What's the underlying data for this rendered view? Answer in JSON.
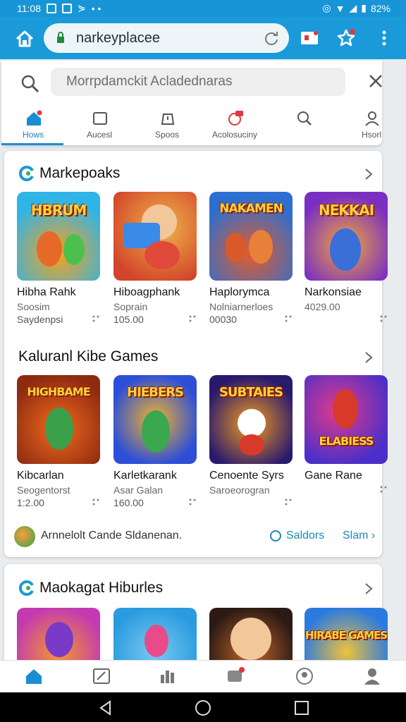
{
  "status_bar": {
    "time": "11:08",
    "battery": "82%"
  },
  "browser": {
    "url": "narkeyplacee"
  },
  "search": {
    "placeholder": "Morrpdamckit Acladednaras"
  },
  "tabs": [
    {
      "label": "Hows",
      "icon": "home-icon",
      "active": true
    },
    {
      "label": "Aucesl",
      "icon": "square-icon",
      "active": false
    },
    {
      "label": "Spoos",
      "icon": "alert-icon",
      "active": false
    },
    {
      "label": "Acolosuciny",
      "icon": "chat-icon",
      "active": false
    },
    {
      "label": "",
      "icon": "search-icon",
      "active": false
    },
    {
      "label": "Hsorl",
      "icon": "person-icon",
      "active": false
    }
  ],
  "sections": [
    {
      "title": "Markepoaks",
      "games": [
        {
          "art": "HBRUM",
          "name": "Hibha Rahk",
          "sub": "Soosim",
          "price": "Saydenpsi",
          "c1": "#2fb4e8",
          "c2": "#f7a21b"
        },
        {
          "art": "",
          "name": "Hiboagphank",
          "sub": "Soprain",
          "price": "105.00",
          "c1": "#f0b44a",
          "c2": "#d2452a"
        },
        {
          "art": "NAKAMEN",
          "name": "Haplorymca",
          "sub": "Nolniarnerloes",
          "price": "00030",
          "c1": "#2c6fd1",
          "c2": "#e45b2c"
        },
        {
          "art": "NEKKAI",
          "name": "Narkonsiae",
          "sub": "4029.00",
          "price": "",
          "c1": "#7a2fc2",
          "c2": "#f2a63c"
        }
      ]
    },
    {
      "title": "Kaluranl Kibe Games",
      "games": [
        {
          "art": "HIGHBAME",
          "name": "Kibcarlan",
          "sub": "Seogentorst",
          "price": "1:2.00",
          "c1": "#f06a1e",
          "c2": "#8e2a10"
        },
        {
          "art": "HIEBERS",
          "name": "Karletkarank",
          "sub": "Asar Galan",
          "price": "160.00",
          "c1": "#2d4fd8",
          "c2": "#f3b22a"
        },
        {
          "art": "SUBTAIES",
          "name": "Cenoente Syrs",
          "sub": "Saroeorogran",
          "price": "",
          "c1": "#2a1a6e",
          "c2": "#f29a1e"
        },
        {
          "art": "ELABIESS",
          "name": "Gane Rane",
          "sub": "",
          "price": "",
          "c1": "#4b2fc8",
          "c2": "#e23a8a"
        }
      ]
    },
    {
      "title": "Maokagat Hiburles",
      "games": [
        {
          "art": "",
          "name": "",
          "sub": "",
          "price": "",
          "c1": "#c43ab0",
          "c2": "#f29a2c"
        },
        {
          "art": "",
          "name": "",
          "sub": "",
          "price": "",
          "c1": "#2a9be0",
          "c2": "#7acaf0"
        },
        {
          "art": "",
          "name": "",
          "sub": "",
          "price": "",
          "c1": "#2b1a14",
          "c2": "#c2672c"
        },
        {
          "art": "HIRABE GAMES",
          "name": "",
          "sub": "",
          "price": "",
          "c1": "#2a7ae0",
          "c2": "#f0c23a"
        }
      ]
    }
  ],
  "promo": {
    "text": "Arnnelolt Cande Sldanenan.",
    "link1": "Saldors",
    "link2": "Slam"
  },
  "colors": {
    "accent": "#1a9ad9",
    "link": "#1a8ab8"
  }
}
